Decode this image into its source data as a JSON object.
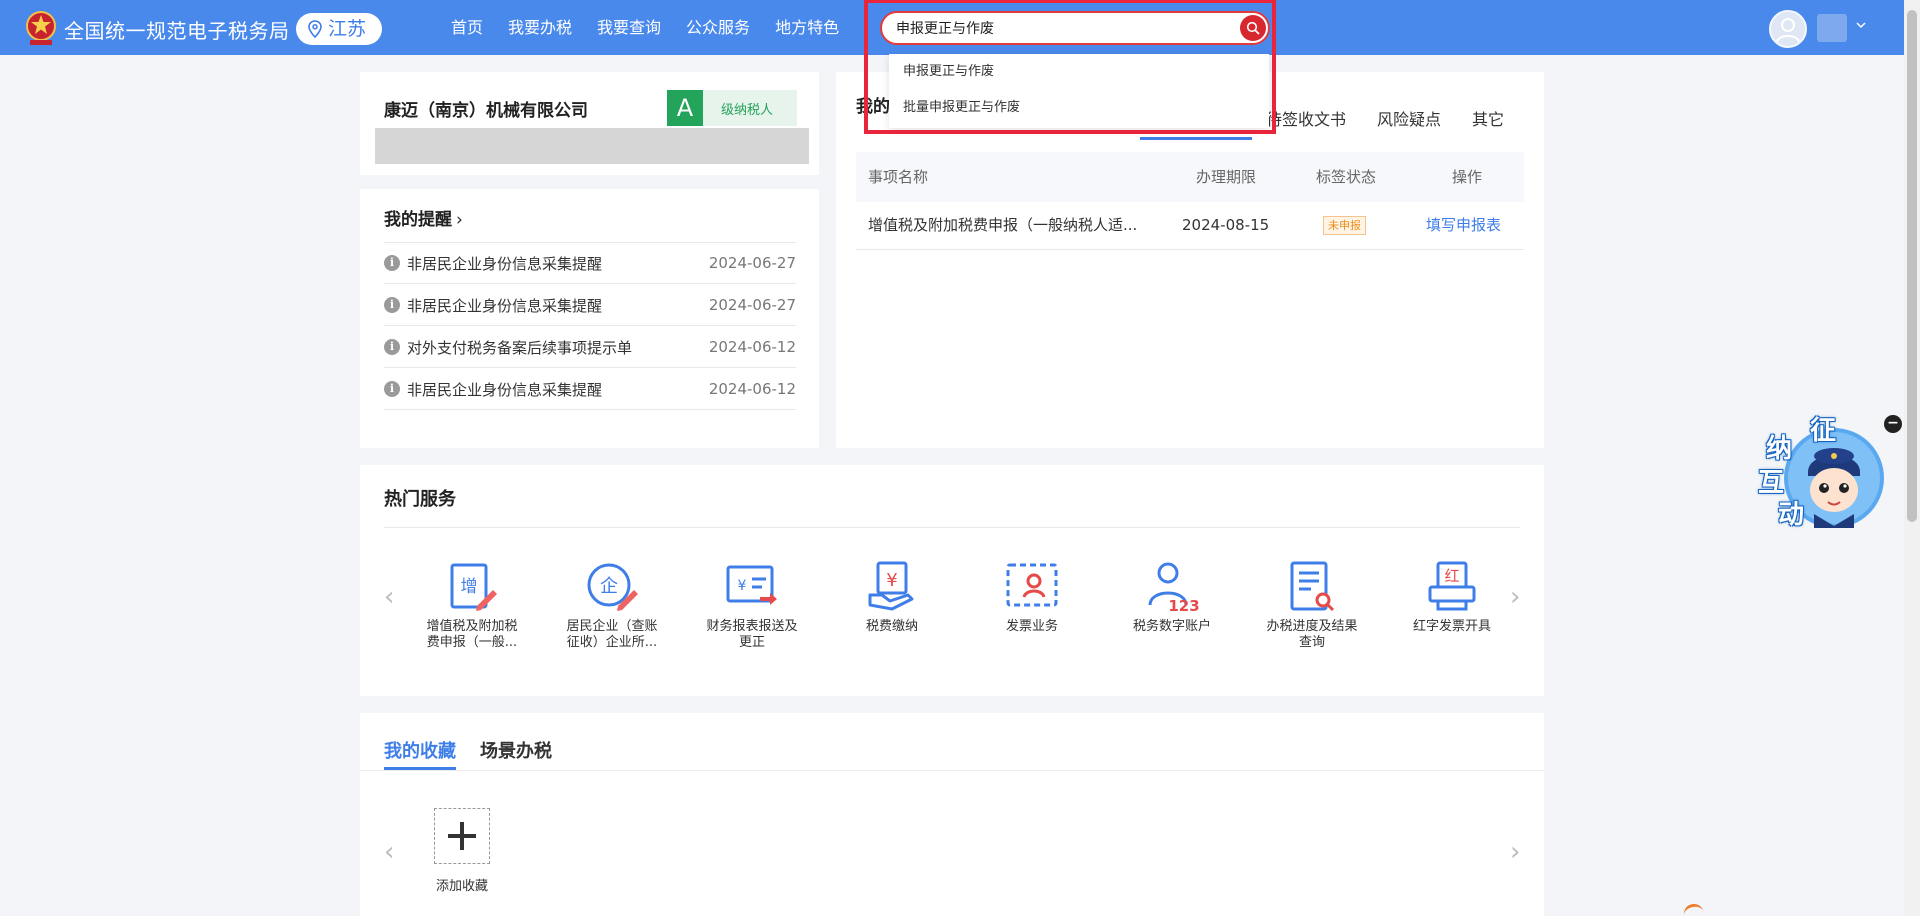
{
  "header": {
    "site_title": "全国统一规范电子税务局",
    "region": "江苏",
    "nav": [
      "首页",
      "我要办税",
      "我要查询",
      "公众服务",
      "地方特色"
    ],
    "search": {
      "value": "申报更正与作废",
      "suggestions": [
        "申报更正与作废",
        "批量申报更正与作废"
      ]
    },
    "colors": {
      "bar": "#4a89ec",
      "search_button": "#d7272f",
      "highlight": "#e8253a"
    }
  },
  "company": {
    "name": "康迈（南京）机械有限公司",
    "grade": "A",
    "grade_suffix": "级纳税人"
  },
  "reminders": {
    "title": "我的提醒",
    "items": [
      {
        "text": "非居民企业身份信息采集提醒",
        "date": "2024-06-27"
      },
      {
        "text": "非居民企业身份信息采集提醒",
        "date": "2024-06-27"
      },
      {
        "text": "对外支付税务备案后续事项提示单",
        "date": "2024-06-12"
      },
      {
        "text": "非居民企业身份信息采集提醒",
        "date": "2024-06-12"
      }
    ]
  },
  "matters": {
    "title_partial": "我的",
    "tabs": [
      "待签收文书",
      "风险疑点",
      "其它"
    ],
    "columns": [
      "事项名称",
      "办理期限",
      "标签状态",
      "操作"
    ],
    "rows": [
      {
        "name": "增值税及附加税费申报（一般纳税人适...",
        "deadline": "2024-08-15",
        "status": "未申报",
        "action": "填写申报表"
      }
    ]
  },
  "hot_services": {
    "title": "热门服务",
    "items": [
      {
        "icon": "vat-declaration-icon",
        "line1": "增值税及附加税",
        "line2": "费申报（一般..."
      },
      {
        "icon": "enterprise-icon",
        "line1": "居民企业（查账",
        "line2": "征收）企业所..."
      },
      {
        "icon": "financial-report-icon",
        "line1": "财务报表报送及",
        "line2": "更正"
      },
      {
        "icon": "tax-payment-icon",
        "line1": "税费缴纳",
        "line2": ""
      },
      {
        "icon": "invoice-icon",
        "line1": "发票业务",
        "line2": ""
      },
      {
        "icon": "digital-account-icon",
        "line1": "税务数字账户",
        "line2": ""
      },
      {
        "icon": "progress-query-icon",
        "line1": "办税进度及结果",
        "line2": "查询"
      },
      {
        "icon": "red-invoice-icon",
        "line1": "红字发票开具",
        "line2": ""
      }
    ]
  },
  "favorites": {
    "tabs": [
      "我的收藏",
      "场景办税"
    ],
    "add_label": "添加收藏"
  },
  "mascot": {
    "chars": [
      "征",
      "纳",
      "互",
      "动"
    ],
    "close": "−"
  }
}
